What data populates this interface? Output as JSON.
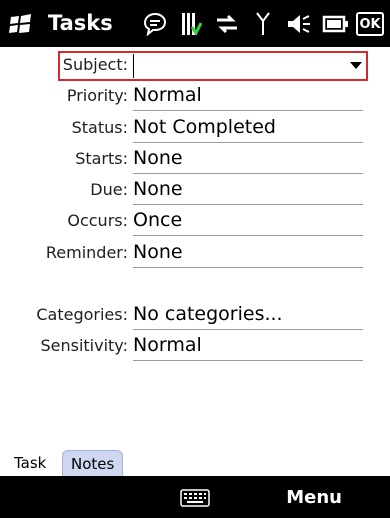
{
  "titlebar": {
    "title": "Tasks",
    "ok_label": "OK"
  },
  "form": {
    "subject_label": "Subject:",
    "subject_value": "",
    "fields": [
      {
        "label": "Priority:",
        "value": "Normal"
      },
      {
        "label": "Status:",
        "value": "Not Completed"
      },
      {
        "label": "Starts:",
        "value": "None"
      },
      {
        "label": "Due:",
        "value": "None"
      },
      {
        "label": "Occurs:",
        "value": "Once"
      },
      {
        "label": "Reminder:",
        "value": "None"
      },
      {
        "label": "Categories:",
        "value": "No categories..."
      },
      {
        "label": "Sensitivity:",
        "value": "Normal"
      }
    ]
  },
  "tabs": [
    {
      "label": "Task"
    },
    {
      "label": "Notes"
    }
  ],
  "softkeys": {
    "right": "Menu"
  },
  "colors": {
    "highlight_border": "#d22b2b",
    "bar_background": "#000000",
    "notes_tab": "#cfd6f0"
  }
}
